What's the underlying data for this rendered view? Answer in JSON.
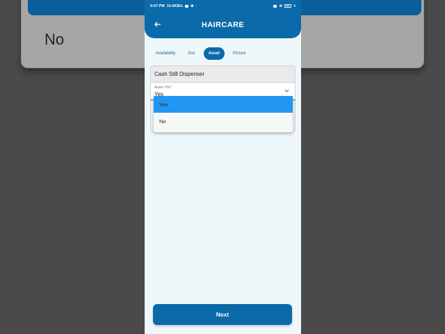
{
  "background": {
    "zoomed_text": "No"
  },
  "status_bar": {
    "time": "6:07 PM",
    "speed": "10.6KB/s",
    "battery_level": "88"
  },
  "header": {
    "title": "HAIRCARE",
    "back_icon": "arrow-left-icon"
  },
  "tabs": [
    {
      "label": "Availability",
      "active": false
    },
    {
      "label": "Sos",
      "active": false
    },
    {
      "label": "Asset",
      "active": true
    },
    {
      "label": "Picture",
      "active": false
    }
  ],
  "form": {
    "item_name": "Cash Still Dispenser",
    "asset_field": {
      "label": "Asset Y/N *",
      "value": "Yes"
    }
  },
  "dropdown": {
    "options": [
      {
        "label": "Yes",
        "selected": true
      },
      {
        "label": "No",
        "selected": false
      }
    ]
  },
  "footer": {
    "next_label": "Next"
  },
  "colors": {
    "primary": "#0b6aa9",
    "selected_option": "#2196f3",
    "page_bg": "#eef8fb"
  }
}
